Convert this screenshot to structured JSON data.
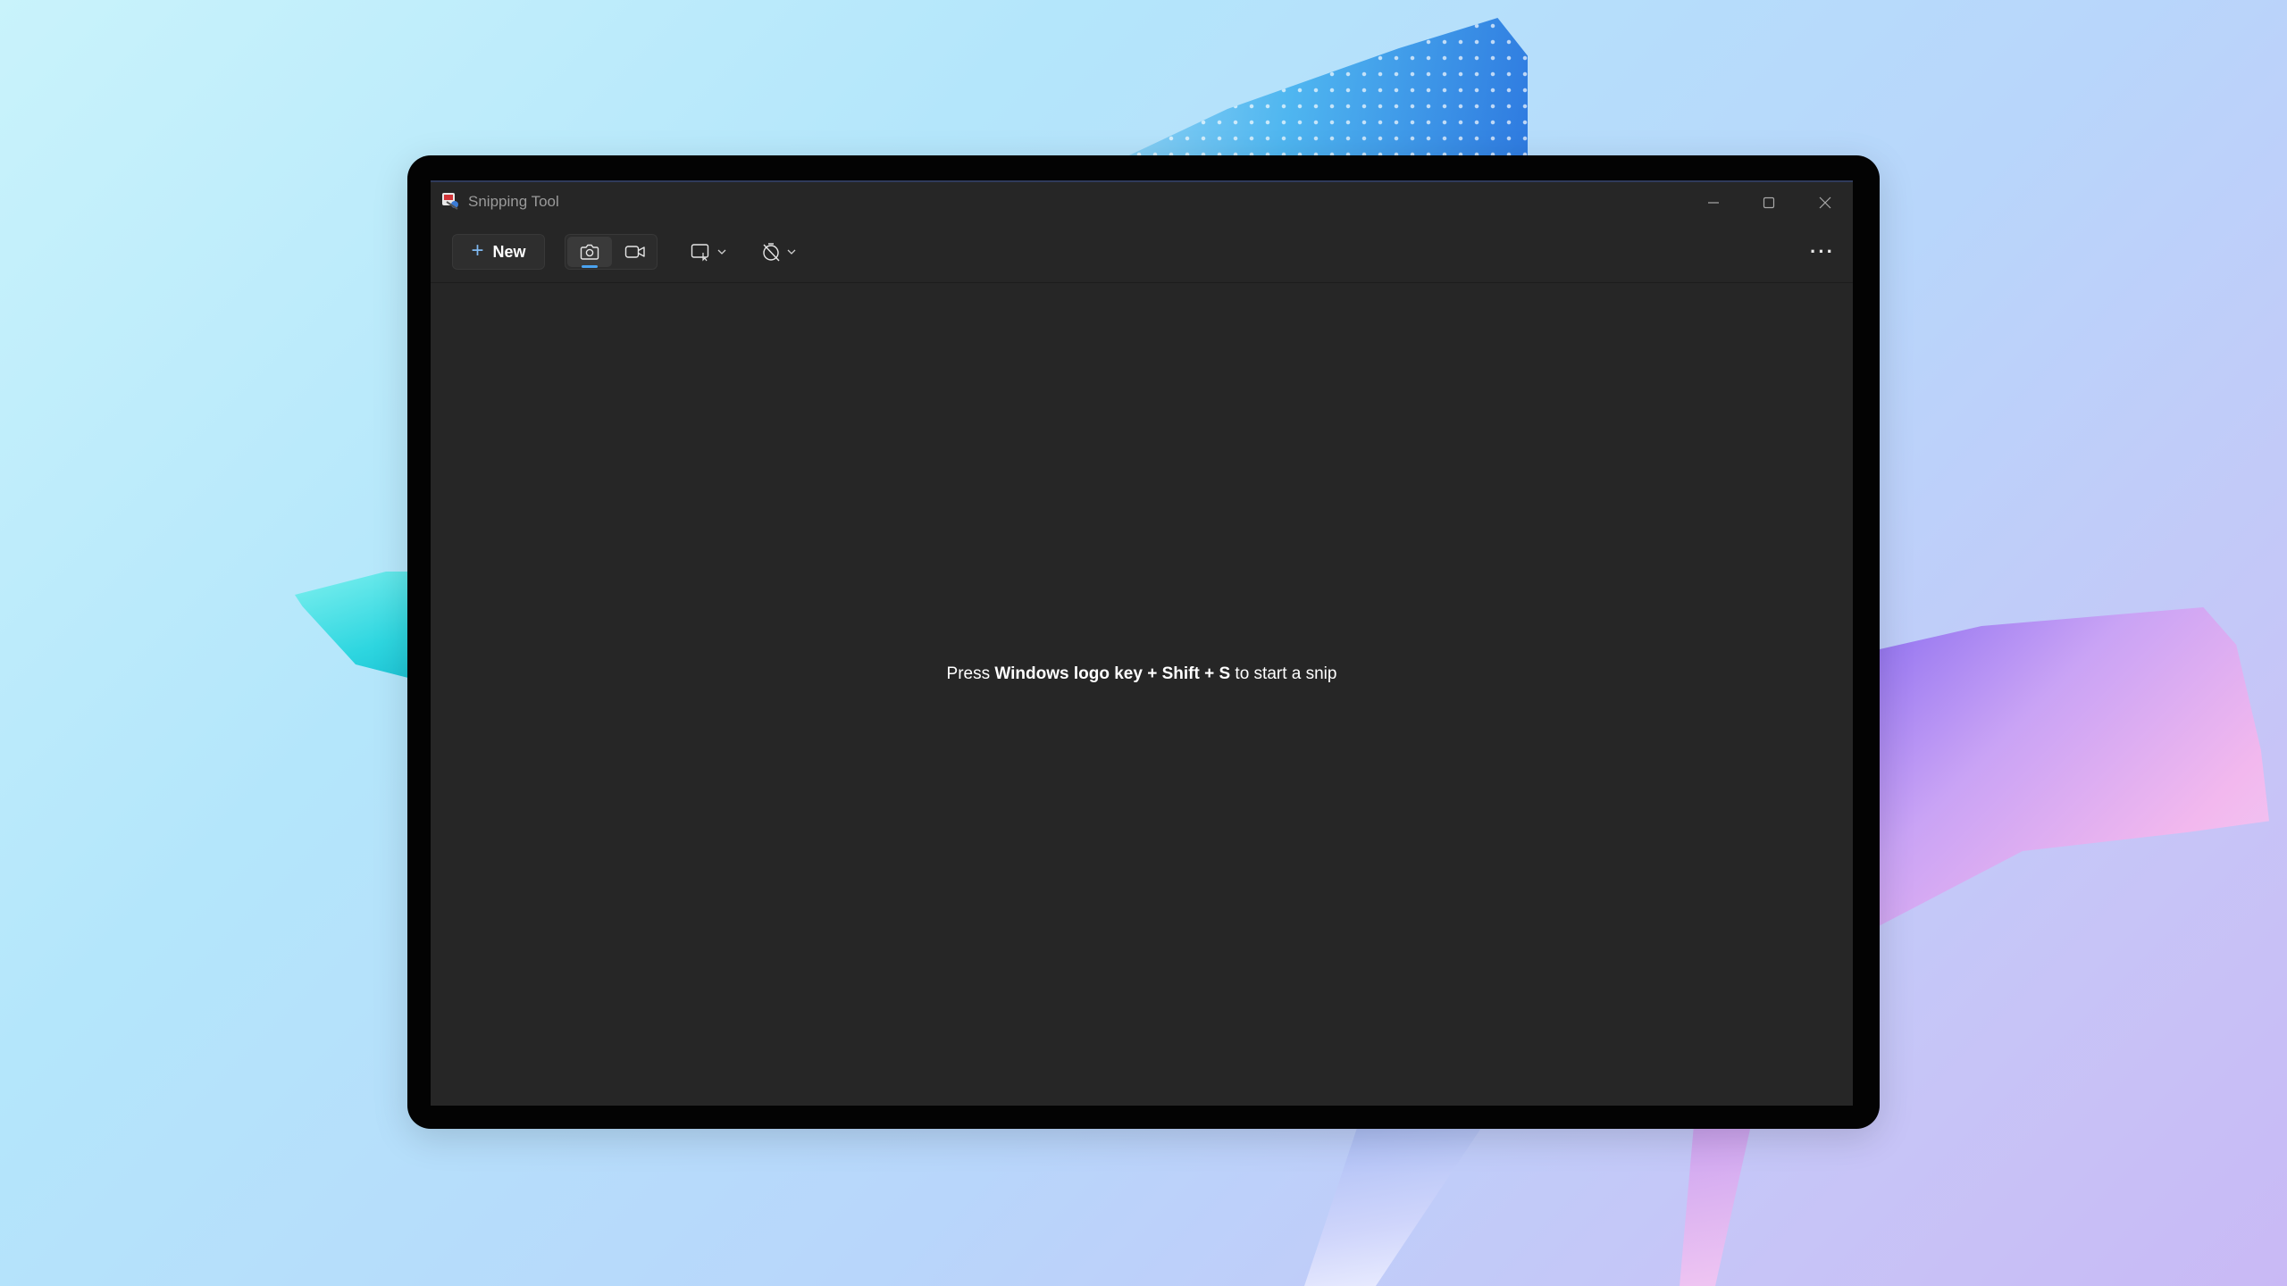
{
  "window": {
    "title": "Snipping Tool"
  },
  "titlebar_buttons": {
    "minimize_icon": "minimize-icon",
    "maximize_icon": "maximize-icon",
    "close_icon": "close-icon"
  },
  "toolbar": {
    "new_label": "New",
    "new_icon": "plus-icon",
    "snip_mode_selected": "snip-photo",
    "photo_icon": "camera-icon",
    "video_icon": "video-camera-icon",
    "shape_icon": "rectangle-snip-icon",
    "timer_icon": "no-delay-timer-icon",
    "more_label": "···"
  },
  "main": {
    "hint_prefix": "Press ",
    "hint_keys": "Windows logo key + Shift + S",
    "hint_suffix": " to start a snip"
  },
  "colors": {
    "window_bg": "#262626",
    "accent": "#4aa3f0",
    "text": "#ffffff",
    "title_text": "#9a9a9a"
  }
}
